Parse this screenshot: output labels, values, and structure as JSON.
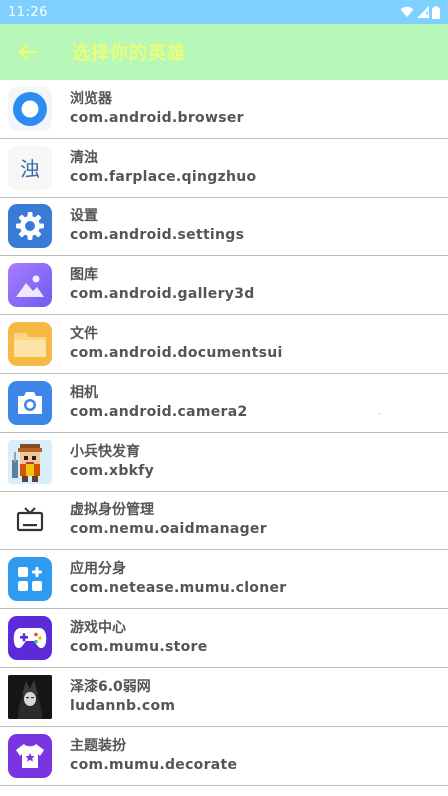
{
  "status_bar": {
    "time": "11:26"
  },
  "app_bar": {
    "title": "选择你的英雄"
  },
  "apps": [
    {
      "name": "浏览器",
      "package": "com.android.browser",
      "icon": "browser-icon"
    },
    {
      "name": "清浊",
      "package": "com.farplace.qingzhuo",
      "icon": "qingzhuo-icon",
      "icon_text": "浊"
    },
    {
      "name": "设置",
      "package": "com.android.settings",
      "icon": "settings-gear-icon"
    },
    {
      "name": "图库",
      "package": "com.android.gallery3d",
      "icon": "gallery-icon"
    },
    {
      "name": "文件",
      "package": "com.android.documentsui",
      "icon": "folder-icon"
    },
    {
      "name": "相机",
      "package": "com.android.camera2",
      "icon": "camera-icon"
    },
    {
      "name": "小兵快发育",
      "package": "com.xbkfy",
      "icon": "pixel-soldier-icon"
    },
    {
      "name": "虚拟身份管理",
      "package": "com.nemu.oaidmanager",
      "icon": "tv-icon"
    },
    {
      "name": "应用分身",
      "package": "com.netease.mumu.cloner",
      "icon": "cloner-icon"
    },
    {
      "name": "游戏中心",
      "package": "com.mumu.store",
      "icon": "gamepad-icon"
    },
    {
      "name": "泽漆6.0弱网",
      "package": "ludannb.com",
      "icon": "dark-portrait-icon"
    },
    {
      "name": "主题装扮",
      "package": "com.mumu.decorate",
      "icon": "shirt-icon"
    }
  ]
}
